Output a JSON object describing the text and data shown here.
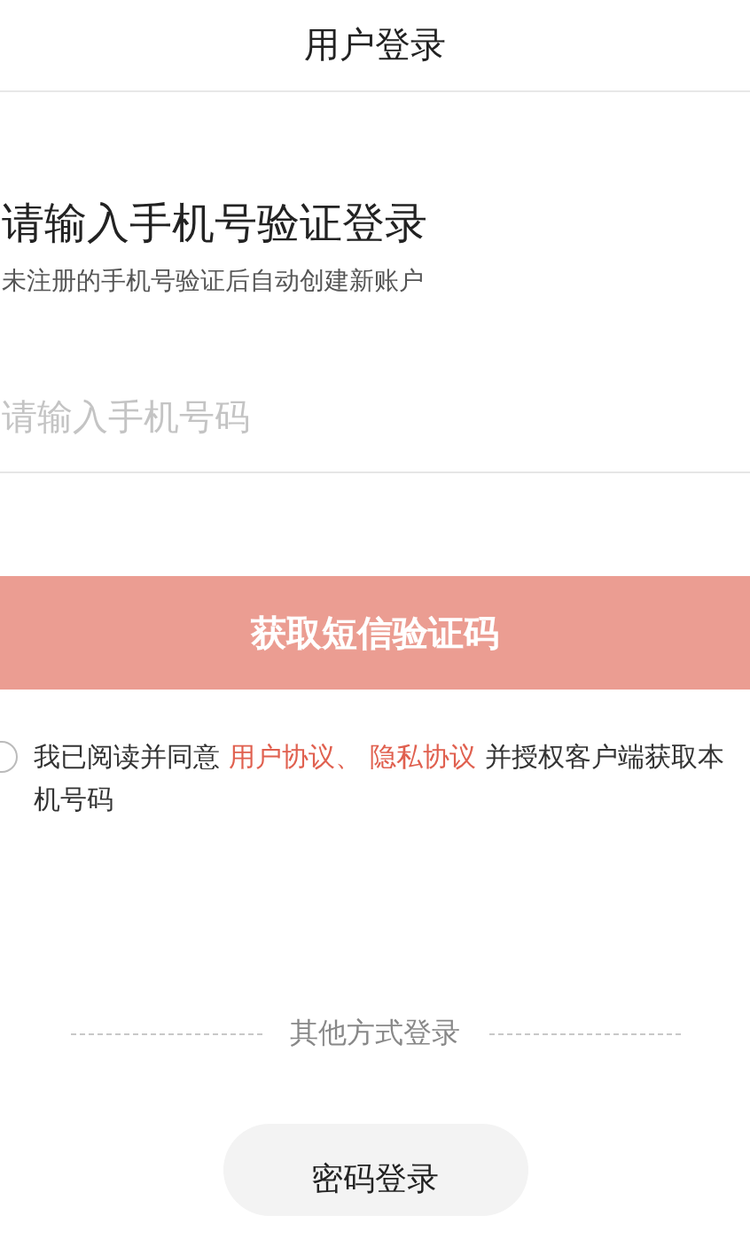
{
  "header": {
    "title": "用户登录"
  },
  "heading": "请输入手机号验证登录",
  "subheading": "未注册的手机号验证后自动创建新账户",
  "phone_input": {
    "placeholder": "请输入手机号码"
  },
  "sms_button": {
    "label": "获取短信验证码",
    "disabled": true
  },
  "agreement": {
    "checked": false,
    "prefix": "我已阅读并同意",
    "links": [
      "用户协议、",
      "隐私协议"
    ],
    "suffix": "并授权客户端获取本机号码"
  },
  "other_login": {
    "label": "其他方式登录",
    "buttons": [
      "密码登录"
    ]
  }
}
